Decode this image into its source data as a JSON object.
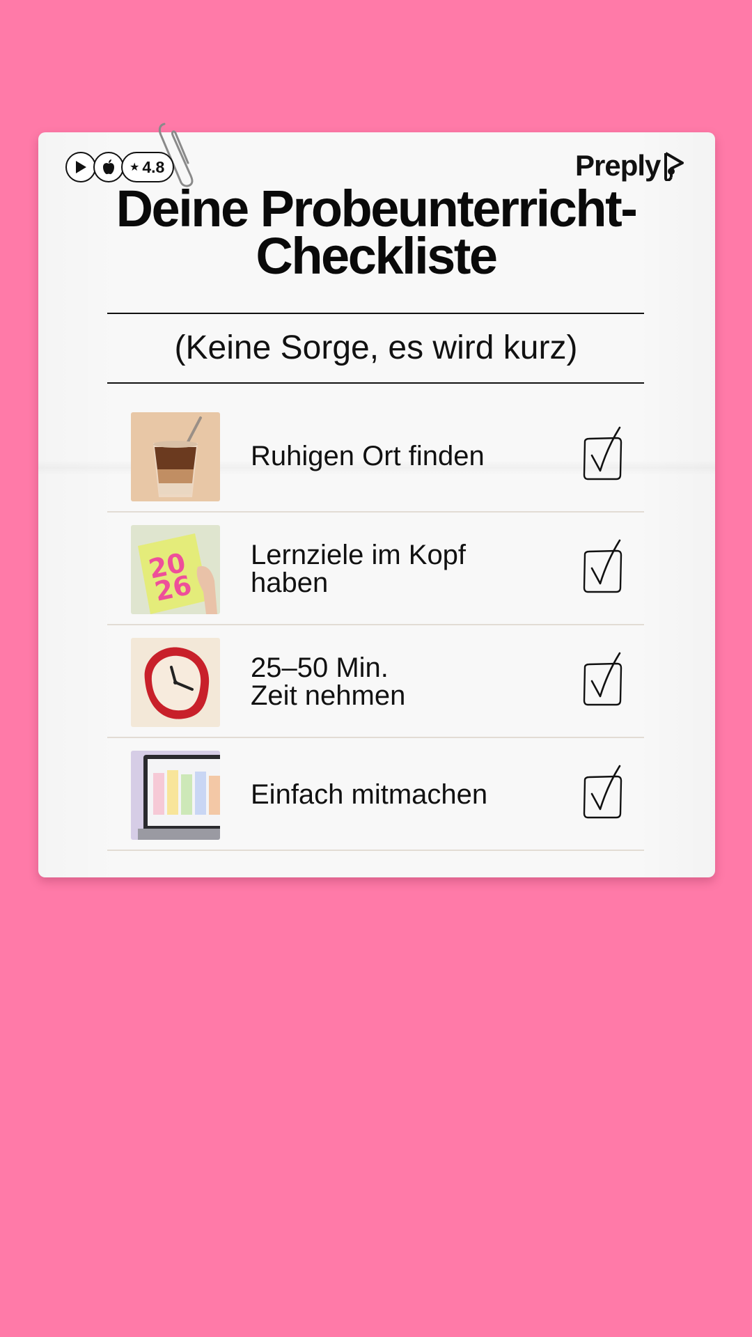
{
  "background_color": "#ff7aa8",
  "store_badges": {
    "icons": [
      "play-store-icon",
      "apple-icon"
    ],
    "rating": "4.8"
  },
  "logo": {
    "text": "Preply"
  },
  "title": {
    "line1": "Deine Probeunterricht-",
    "line2": "Checkliste"
  },
  "subtitle": "(Keine Sorge, es wird kurz)",
  "checklist": [
    {
      "thumb_icon": "iced-coffee-icon",
      "line1": "Ruhigen Ort finden",
      "line2": "",
      "checked": true
    },
    {
      "thumb_icon": "planner-2026-icon",
      "line1": "Lernziele im Kopf",
      "line2": "haben",
      "checked": true
    },
    {
      "thumb_icon": "melting-clock-icon",
      "line1": "25–50 Min.",
      "line2": "Zeit nehmen",
      "checked": true
    },
    {
      "thumb_icon": "laptop-calendar-icon",
      "line1": "Einfach mitmachen",
      "line2": "",
      "checked": true
    }
  ]
}
